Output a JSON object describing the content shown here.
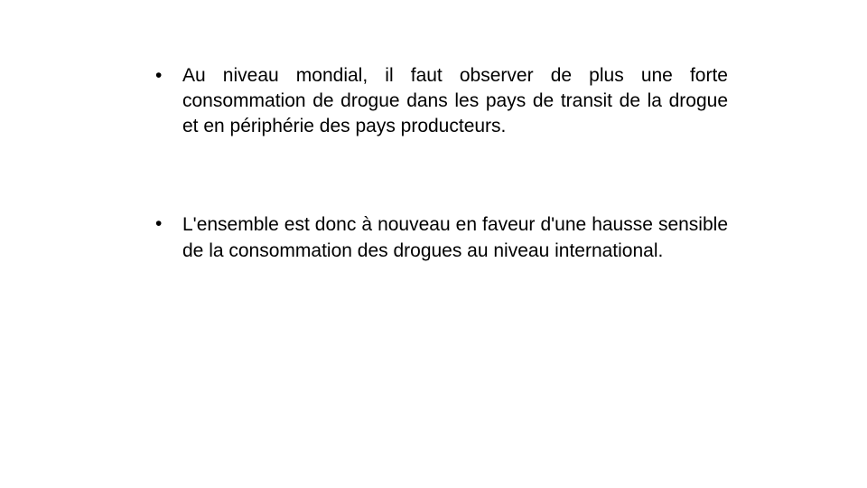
{
  "slide": {
    "bullet_symbol": "•",
    "bullets": [
      {
        "text": "Au niveau mondial, il faut observer de plus une forte consommation de drogue dans les pays de transit de la drogue et en périphérie des pays producteurs."
      },
      {
        "text": "L'ensemble est donc à nouveau en faveur d'une hausse sensible de la consommation des drogues au niveau international."
      }
    ]
  }
}
